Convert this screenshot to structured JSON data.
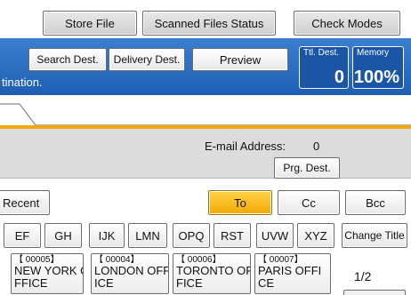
{
  "top_buttons": {
    "store_file": "Store File",
    "scanned_files_status": "Scanned Files Status",
    "check_modes": "Check Modes"
  },
  "header": {
    "search_dest": "Search Dest.",
    "delivery_dest": "Delivery Dest.",
    "preview": "Preview",
    "band_text": "tination."
  },
  "counters": {
    "ttl_dest_caption": "Ttl. Dest.",
    "ttl_dest_value": "0",
    "memory_caption": "Memory",
    "memory_value": "100%"
  },
  "info": {
    "email_label": "E-mail Address:",
    "email_count": "0",
    "prg_dest": "Prg. Dest."
  },
  "recipient_row": {
    "recent": "Recent",
    "to": "To",
    "cc": "Cc",
    "bcc": "Bcc"
  },
  "index_tabs": [
    "EF",
    "GH",
    "IJK",
    "LMN",
    "OPQ",
    "RST",
    "UVW",
    "XYZ"
  ],
  "change_title": "Change Title",
  "destinations": [
    {
      "num": "【 00005】",
      "line1": "NEW YORK O",
      "line2": "FFICE"
    },
    {
      "num": "【 00004】",
      "line1": "LONDON OFF",
      "line2": "ICE"
    },
    {
      "num": "【 00006】",
      "line1": "TORONTO OF",
      "line2": "FICE"
    },
    {
      "num": "【 00007】",
      "line1": "PARIS OFFI",
      "line2": "CE"
    }
  ],
  "page_indicator": "1/2",
  "colors": {
    "accent_blue": "#1e5eb3",
    "active_orange": "#f2a900"
  }
}
